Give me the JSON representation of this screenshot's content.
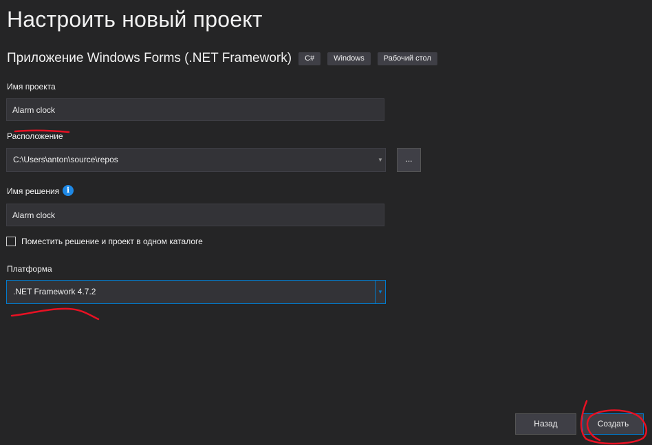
{
  "header": {
    "title": "Настроить новый проект",
    "template_name": "Приложение Windows Forms (.NET Framework)",
    "tags": [
      "C#",
      "Windows",
      "Рабочий стол"
    ]
  },
  "form": {
    "project_name": {
      "label": "Имя проекта",
      "value": "Alarm clock"
    },
    "location": {
      "label": "Расположение",
      "value": "C:\\Users\\anton\\source\\repos",
      "browse_label": "..."
    },
    "solution_name": {
      "label": "Имя решения",
      "value": "Alarm clock",
      "info_icon": "i"
    },
    "same_directory": {
      "label": "Поместить решение и проект в одном каталоге",
      "checked": false
    },
    "framework": {
      "label": "Платформа",
      "value": ".NET Framework 4.7.2"
    }
  },
  "footer": {
    "back_label": "Назад",
    "create_label": "Создать"
  },
  "colors": {
    "background": "#252526",
    "field": "#333337",
    "accent": "#007acc",
    "annotation": "#e81123"
  }
}
